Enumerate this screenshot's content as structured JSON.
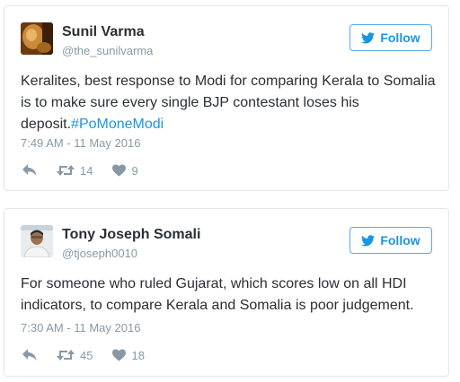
{
  "tweets": [
    {
      "name": "Sunil Varma",
      "handle": "@the_sunilvarma",
      "follow_label": "Follow",
      "text": "Keralites, best response to Modi for comparing Kerala to Somalia is to make sure every single BJP contestant loses his deposit.",
      "hashtag": "#PoMoneModi",
      "timestamp": "7:49 AM - 11 May 2016",
      "retweets": "14",
      "likes": "9"
    },
    {
      "name": "Tony Joseph Somali",
      "handle": "@tjoseph0010",
      "follow_label": "Follow",
      "text": "For someone who ruled Gujarat, which scores low on all HDI indicators, to compare Kerala and Somalia is poor judgement.",
      "timestamp": "7:30 AM - 11 May 2016",
      "retweets": "45",
      "likes": "18"
    }
  ],
  "icons": {
    "follow": "twitter-bird-icon",
    "reply": "reply-icon",
    "retweet": "retweet-icon",
    "like": "heart-icon"
  },
  "colors": {
    "brand": "#1b95e0",
    "border": "#e1e8ed",
    "muted": "#8899a6",
    "text": "#292f33"
  }
}
